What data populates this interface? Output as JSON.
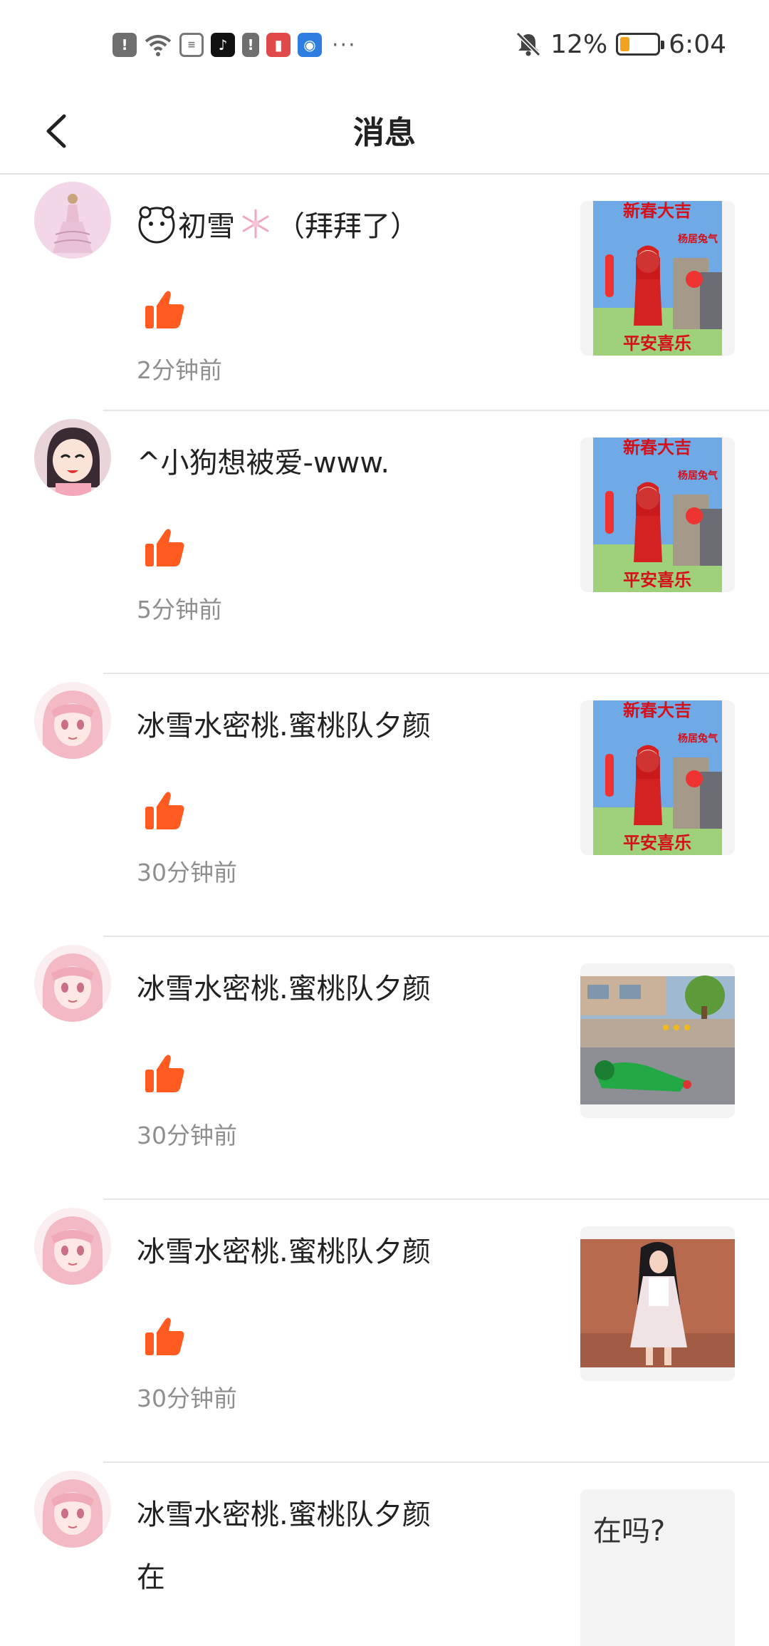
{
  "status_bar": {
    "battery_percent": "12%",
    "battery_level": 0.12,
    "time": "6:04",
    "left_icons": [
      "alert-icon",
      "wifi-icon",
      "document-icon",
      "tiktok-icon",
      "alert-icon",
      "reader-icon",
      "bulb-icon",
      "more-icon"
    ],
    "right_icons": [
      "mute-icon",
      "battery-icon"
    ],
    "more": "···"
  },
  "header": {
    "title": "消息",
    "back_icon": "chevron-left-icon"
  },
  "colors": {
    "like": "#ff5a1f",
    "divider": "#e6e6e6",
    "muted_text": "#8f8f8f"
  },
  "messages": [
    {
      "name": "初雪",
      "name_suffix": "（拜拜了）",
      "time": "2分钟前",
      "thumb": "festive-image",
      "avatar": "princess-avatar",
      "name_prefix_icon": "cartoon-face-icon",
      "name_mid_icon": "snowflake-icon"
    },
    {
      "name": "^小狗想被爱-www.",
      "time": "5分钟前",
      "thumb": "festive-image",
      "avatar": "anime-girl-avatar"
    },
    {
      "name": "冰雪水密桃.蜜桃队夕颜",
      "time": "30分钟前",
      "thumb": "festive-image",
      "avatar": "pink-hair-avatar"
    },
    {
      "name": "冰雪水密桃.蜜桃队夕颜",
      "time": "30分钟前",
      "thumb": "schoolyard-image",
      "avatar": "pink-hair-avatar"
    },
    {
      "name": "冰雪水密桃.蜜桃队夕颜",
      "time": "30分钟前",
      "thumb": "maid-image",
      "avatar": "pink-hair-avatar"
    },
    {
      "name": "冰雪水密桃.蜜桃队夕颜",
      "reply": "在",
      "quoted": "在吗?",
      "avatar": "pink-hair-avatar"
    }
  ],
  "festive_thumb": {
    "top_text": "新春大吉",
    "mid_text": "杨居兔气",
    "bottom_text": "平安喜乐"
  }
}
